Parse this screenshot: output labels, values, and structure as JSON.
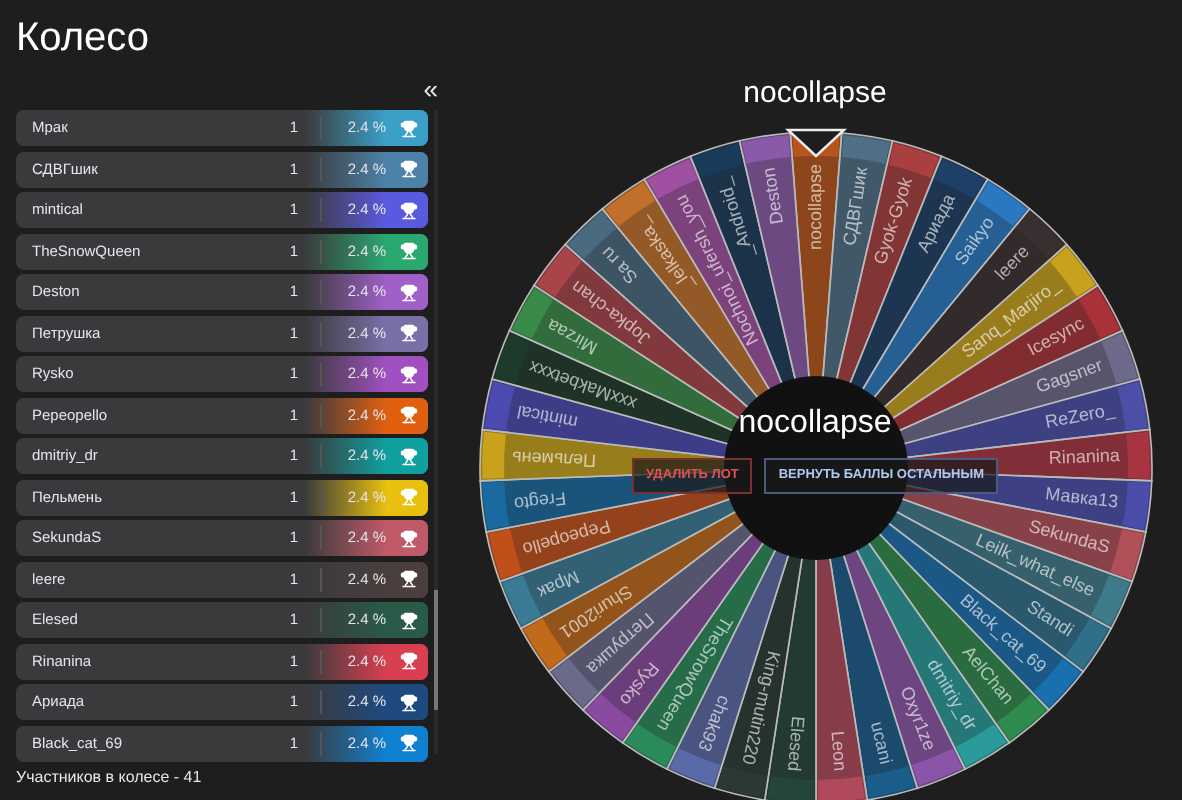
{
  "title": "Колесо",
  "collapse_button": "«",
  "participants": [
    {
      "name": "Мрак",
      "count": "1",
      "chance": "2.4 %",
      "color": "#3ba0c8"
    },
    {
      "name": "СДВГшик",
      "count": "1",
      "chance": "2.4 %",
      "color": "#4d82a8"
    },
    {
      "name": "mintical",
      "count": "1",
      "chance": "2.4 %",
      "color": "#5a5ae0"
    },
    {
      "name": "TheSnowQueen",
      "count": "1",
      "chance": "2.4 %",
      "color": "#2aa870"
    },
    {
      "name": "Deston",
      "count": "1",
      "chance": "2.4 %",
      "color": "#a060c8"
    },
    {
      "name": "Петрушка",
      "count": "1",
      "chance": "2.4 %",
      "color": "#7a70a8"
    },
    {
      "name": "Rysko",
      "count": "1",
      "chance": "2.4 %",
      "color": "#a050c0"
    },
    {
      "name": "Pepeopello",
      "count": "1",
      "chance": "2.4 %",
      "color": "#e06010"
    },
    {
      "name": "dmitriy_dr",
      "count": "1",
      "chance": "2.4 %",
      "color": "#10a0a0"
    },
    {
      "name": "Пельмень",
      "count": "1",
      "chance": "2.4 %",
      "color": "#e8c010"
    },
    {
      "name": "SekundaS",
      "count": "1",
      "chance": "2.4 %",
      "color": "#c05a68"
    },
    {
      "name": "leere",
      "count": "1",
      "chance": "2.4 %",
      "color": "#4a3e3e"
    },
    {
      "name": "Elesed",
      "count": "1",
      "chance": "2.4 %",
      "color": "#2a5a48"
    },
    {
      "name": "Rinanina",
      "count": "1",
      "chance": "2.4 %",
      "color": "#d84050"
    },
    {
      "name": "Ариада",
      "count": "1",
      "chance": "2.4 %",
      "color": "#1e4a80"
    },
    {
      "name": "Black_cat_69",
      "count": "1",
      "chance": "2.4 %",
      "color": "#1080d0"
    }
  ],
  "footer": "Участников в колесе - 41",
  "wheel": {
    "winner_title": "nocollapse",
    "center_label": "nocollapse",
    "buttons": [
      {
        "label": "УДАЛИТЬ ЛОТ",
        "kind": "danger"
      },
      {
        "label": "ВЕРНУТЬ БАЛЛЫ ОСТАЛЬНЫМ",
        "kind": "primary"
      }
    ],
    "segments": [
      {
        "label": "nocollapse",
        "color": "#b8541c"
      },
      {
        "label": "СДВГшик",
        "color": "#4f6f86"
      },
      {
        "label": "Gyok-Gyok",
        "color": "#a8403f"
      },
      {
        "label": "Ариада",
        "color": "#1e3f66"
      },
      {
        "label": "Saikyo",
        "color": "#2a78c0"
      },
      {
        "label": "leere",
        "color": "#3a2f30"
      },
      {
        "label": "Sanq_Marjiro_",
        "color": "#c9a21d"
      },
      {
        "label": "Icesync",
        "color": "#a83238"
      },
      {
        "label": "Gagsner",
        "color": "#6d6a8a"
      },
      {
        "label": "ReZero_",
        "color": "#4b4fa8"
      },
      {
        "label": "Rinanina",
        "color": "#a83442"
      },
      {
        "label": "Мавка13",
        "color": "#4a4eaa"
      },
      {
        "label": "SekundaS",
        "color": "#b0515a"
      },
      {
        "label": "Leilk_what_else",
        "color": "#3e7a8a"
      },
      {
        "label": "Standi",
        "color": "#2f6f8a"
      },
      {
        "label": "Black_cat_69",
        "color": "#1a6fae"
      },
      {
        "label": "AelChan",
        "color": "#2f8a4e"
      },
      {
        "label": "dmitriy_dr",
        "color": "#2a9a9a"
      },
      {
        "label": "Oxyr1ze",
        "color": "#8a55a8"
      },
      {
        "label": "ucani",
        "color": "#1a5c8a"
      },
      {
        "label": "Leon",
        "color": "#b04a5a"
      },
      {
        "label": "Elesed",
        "color": "#254538"
      },
      {
        "label": "King-mutin220",
        "color": "#2a3a33"
      },
      {
        "label": "chak93",
        "color": "#5a6aa8"
      },
      {
        "label": "TheSnowQueen",
        "color": "#2a8a5a"
      },
      {
        "label": "Rysko",
        "color": "#8a4aa0"
      },
      {
        "label": "Петрушка",
        "color": "#6a6a8a"
      },
      {
        "label": "Shuri2001",
        "color": "#c06a1a"
      },
      {
        "label": "Мрак",
        "color": "#3a7a95"
      },
      {
        "label": "Pepeopello",
        "color": "#c0501a"
      },
      {
        "label": "Fregto",
        "color": "#1a6aa0"
      },
      {
        "label": "Пельмень",
        "color": "#c8a21a"
      },
      {
        "label": "mintical",
        "color": "#4a4ab0"
      },
      {
        "label": "xxxMakbetxxx",
        "color": "#1e3a2a"
      },
      {
        "label": "Mirzaa",
        "color": "#3a8a4a"
      },
      {
        "label": "Jopka-chan",
        "color": "#a8444a"
      },
      {
        "label": "Sa ru",
        "color": "#4a6a80"
      },
      {
        "label": "_lelkaska_",
        "color": "#c0702a"
      },
      {
        "label": "Nochnoi_ufersh_you",
        "color": "#a050a0"
      },
      {
        "label": "_Android_",
        "color": "#1a3a5a"
      },
      {
        "label": "Deston",
        "color": "#8a5aa8"
      }
    ]
  }
}
